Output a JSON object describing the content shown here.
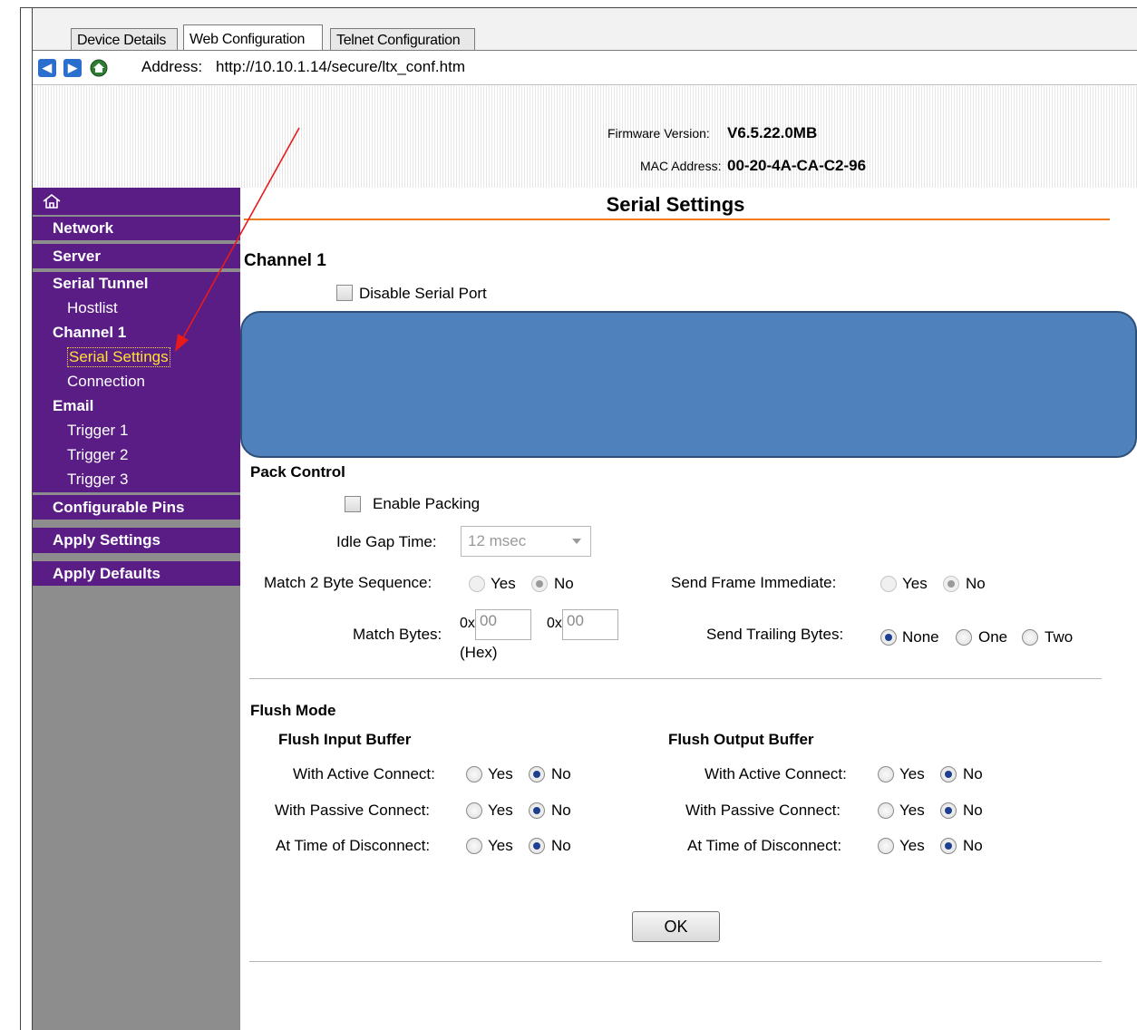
{
  "tabs": [
    "Device Details",
    "Web Configuration",
    "Telnet Configuration"
  ],
  "address": {
    "label": "Address:",
    "url": "http://10.10.1.14/secure/ltx_conf.htm"
  },
  "header": {
    "firmware_label": "Firmware Version:",
    "firmware_value": "V6.5.22.0MB",
    "mac_label": "MAC Address:",
    "mac_value": "00-20-4A-CA-C2-96"
  },
  "sidebar": {
    "home_icon": "home-icon",
    "network": "Network",
    "server": "Server",
    "serial_tunnel": "Serial Tunnel",
    "hostlist": "Hostlist",
    "channel1": "Channel 1",
    "serial_settings": "Serial Settings",
    "connection": "Connection",
    "email": "Email",
    "trigger1": "Trigger 1",
    "trigger2": "Trigger 2",
    "trigger3": "Trigger 3",
    "configurable_pins": "Configurable Pins",
    "apply_settings": "Apply Settings",
    "apply_defaults": "Apply Defaults"
  },
  "main": {
    "title": "Serial Settings",
    "channel": "Channel 1",
    "disable_serial_port": "Disable Serial Port",
    "pack_control": {
      "heading": "Pack Control",
      "enable_packing": "Enable Packing",
      "idle_gap_label": "Idle Gap Time:",
      "idle_gap_value": "12 msec",
      "match2_label": "Match 2 Byte Sequence:",
      "send_frame_label": "Send Frame Immediate:",
      "yes": "Yes",
      "no": "No",
      "match_bytes_label": "Match Bytes:",
      "hex_prefix": "0x",
      "hex_note": "(Hex)",
      "match_byte1": "00",
      "match_byte2": "00",
      "trailing_label": "Send Trailing Bytes:",
      "none": "None",
      "one": "One",
      "two": "Two"
    },
    "flush": {
      "heading": "Flush Mode",
      "input_heading": "Flush Input Buffer",
      "output_heading": "Flush Output Buffer",
      "active": "With Active Connect:",
      "passive": "With Passive Connect:",
      "disconnect": "At Time of Disconnect:",
      "yes": "Yes",
      "no": "No"
    },
    "ok": "OK"
  },
  "colors": {
    "sidebar_purple": "#5a1d86",
    "accent_orange": "#f07a1c",
    "redaction_blue": "#4f81bd"
  }
}
